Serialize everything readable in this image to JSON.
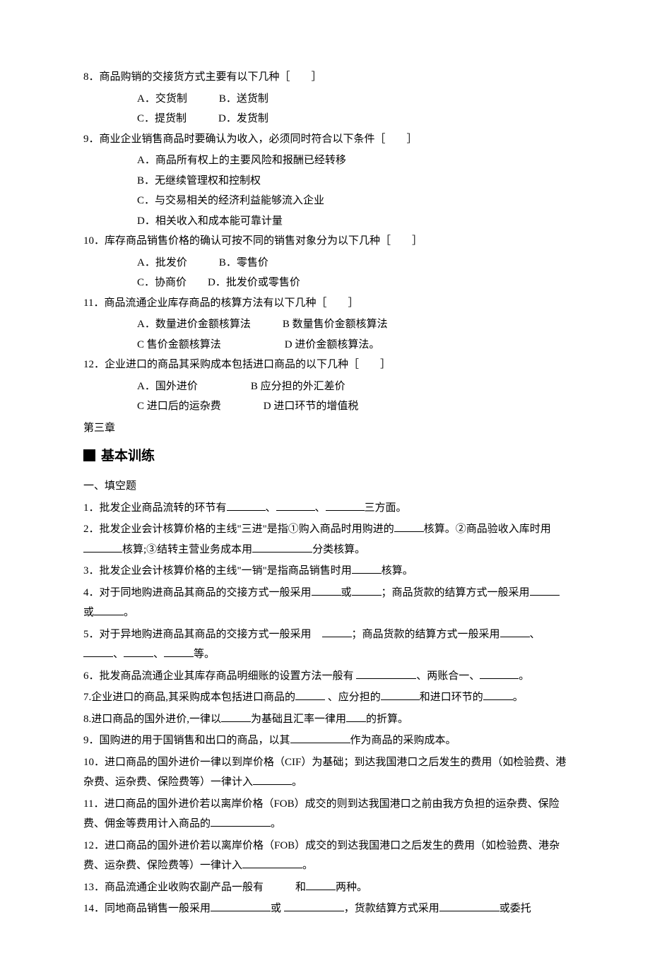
{
  "mc": {
    "q8": {
      "text": "8．商品购销的交接货方式主要有以下几种［　　］",
      "a": "A．交货制",
      "b": "B．送货制",
      "c": "C．提货制",
      "d": "D．发货制"
    },
    "q9": {
      "text": "9．商业企业销售商品时要确认为收入，必须同时符合以下条件［　　］",
      "a": "A．商品所有权上的主要风险和报酬已经转移",
      "b": "B．无继续管理权和控制权",
      "c": "C．与交易相关的经济利益能够流入企业",
      "d": "D．相关收入和成本能可靠计量"
    },
    "q10": {
      "text": "10．库存商品销售价格的确认可按不同的销售对象分为以下几种［　　］",
      "a": "A．批发价",
      "b": "B．零售价",
      "c": "C．协商价",
      "d": "D．批发价或零售价"
    },
    "q11": {
      "text": "11．商品流通企业库存商品的核算方法有以下几种［　　］",
      "a": "A．数量进价金额核算法",
      "b": "B 数量售价金额核算法",
      "c": "C 售价金额核算法",
      "d": "D 进价金额核算法。"
    },
    "q12": {
      "text": "12．企业进口的商品其采购成本包括进口商品的以下几种［　　］",
      "a": "A．国外进价",
      "b": "B 应分担的外汇差价",
      "c": "C 进口后的运杂费",
      "d": "D 进口环节的增值税"
    }
  },
  "chapter": "第三章",
  "section_title": "基本训练",
  "fill_title": "一、填空题",
  "fill": {
    "f1a": "1．批发企业商品流转的环节有",
    "f1b": "三方面。",
    "f2a": "2．批发企业会计核算价格的主线\"三进\"是指①购入商品时用购进的",
    "f2b": "核算。②商品验收入库时用",
    "f2c": "核算;③结转主营业务成本用",
    "f2d": "分类核算。",
    "f3a": "3．批发企业会计核算价格的主线\"一销\"是指商品销售时用",
    "f3b": "核算。",
    "f4a": "4．对于同地购进商品其商品的交接方式一般采用",
    "f4b": "或",
    "f4c": "；商品货款的结算方式一般采用",
    "f4d": "或",
    "f4e": "。",
    "f5a": "5．对于异地购进商品其商品的交接方式一般采用　",
    "f5b": "；商品货款的结算方式一般采用",
    "f5c": "等。",
    "f6a": "6．批发商品流通企业其库存商品明细账的设置方法一般有 ",
    "f6b": "、两账合一、",
    "f6c": "。",
    "f7a": "7.企业进口的商品,其采购成本包括进口商品的",
    "f7b": " 、应分担的",
    "f7c": "和进口环节的",
    "f7d": "。",
    "f8a": "8.进口商品的国外进价,一律以",
    "f8b": "为基础且汇率一律用",
    "f8c": "的折算。",
    "f9a": "9．国购进的用于国销售和出口的商品，以其",
    "f9b": "作为商品的采购成本。",
    "f10a": "10．进口商品的国外进价一律以到岸价格（CIF）为基础；到达我国港口之后发生的费用（如检验费、港杂费、运杂费、保险费等）一律计入",
    "f10b": "。",
    "f11a": "11．进口商品的国外进价若以离岸价格（FOB）成交的则到达我国港口之前由我方负担的运杂费、保险费、佣金等费用计入商品的",
    "f11b": "。",
    "f12a": "12．进口商品的国外进价若以离岸价格（FOB）成交的到达我国港口之后发生的费用（如检验费、港杂费、运杂费、保险费等）一律计入",
    "f12b": "。",
    "f13a": "13．商品流通企业收购农副产品一般有　　　和",
    "f13b": "两种。",
    "f14a": "14．同地商品销售一般采用",
    "f14b": "或 ",
    "f14c": "，货款结算方式采用",
    "f14d": "或委托"
  }
}
